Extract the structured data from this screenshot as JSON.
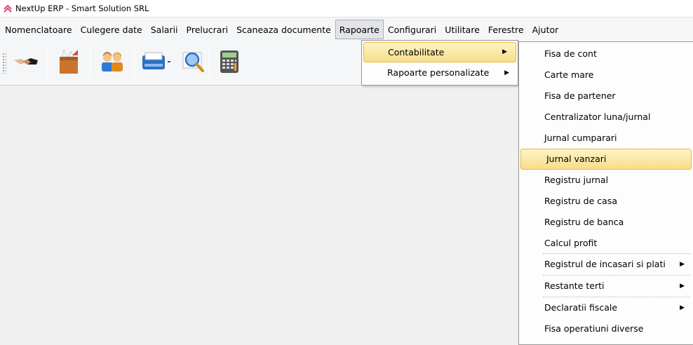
{
  "window": {
    "title": "NextUp ERP - Smart Solution SRL"
  },
  "menubar": {
    "items": [
      {
        "label": "Nomenclatoare"
      },
      {
        "label": "Culegere date"
      },
      {
        "label": "Salarii"
      },
      {
        "label": "Prelucrari"
      },
      {
        "label": "Scaneaza documente"
      },
      {
        "label": "Rapoarte",
        "active": true
      },
      {
        "label": "Configurari"
      },
      {
        "label": "Utilitare"
      },
      {
        "label": "Ferestre"
      },
      {
        "label": "Ajutor"
      }
    ]
  },
  "toolbar": {
    "buttons": [
      {
        "icon": "handshake-icon"
      },
      {
        "icon": "box-icon"
      },
      {
        "icon": "users-icon"
      },
      {
        "icon": "printer-icon"
      },
      {
        "icon": "magnifier-icon"
      },
      {
        "icon": "calculator-icon"
      }
    ]
  },
  "rapoarte_menu": {
    "items": [
      {
        "label": "Contabilitate",
        "submenu": true,
        "highlighted": true
      },
      {
        "label": "Rapoarte personalizate",
        "submenu": true
      }
    ]
  },
  "contabilitate_menu": {
    "items": [
      {
        "label": "Fisa de cont"
      },
      {
        "label": "Carte mare"
      },
      {
        "label": "Fisa de partener"
      },
      {
        "label": "Centralizator luna/jurnal"
      },
      {
        "label": "Jurnal cumparari"
      },
      {
        "label": "Jurnal vanzari",
        "highlighted": true
      },
      {
        "label": "Registru jurnal"
      },
      {
        "label": "Registru de casa"
      },
      {
        "label": "Registru de banca"
      },
      {
        "label": "Calcul profit"
      },
      {
        "label": "Registrul de incasari si plati",
        "submenu": true
      },
      {
        "label": "Restante terti",
        "submenu": true
      },
      {
        "label": "Declaratii fiscale",
        "submenu": true
      },
      {
        "label": "Fisa operatiuni diverse"
      }
    ]
  },
  "colors": {
    "highlight_top": "#fdf4c4",
    "highlight_bottom": "#f8dd8a",
    "highlight_border": "#e6b94a",
    "app_icon": "#e0407a"
  }
}
